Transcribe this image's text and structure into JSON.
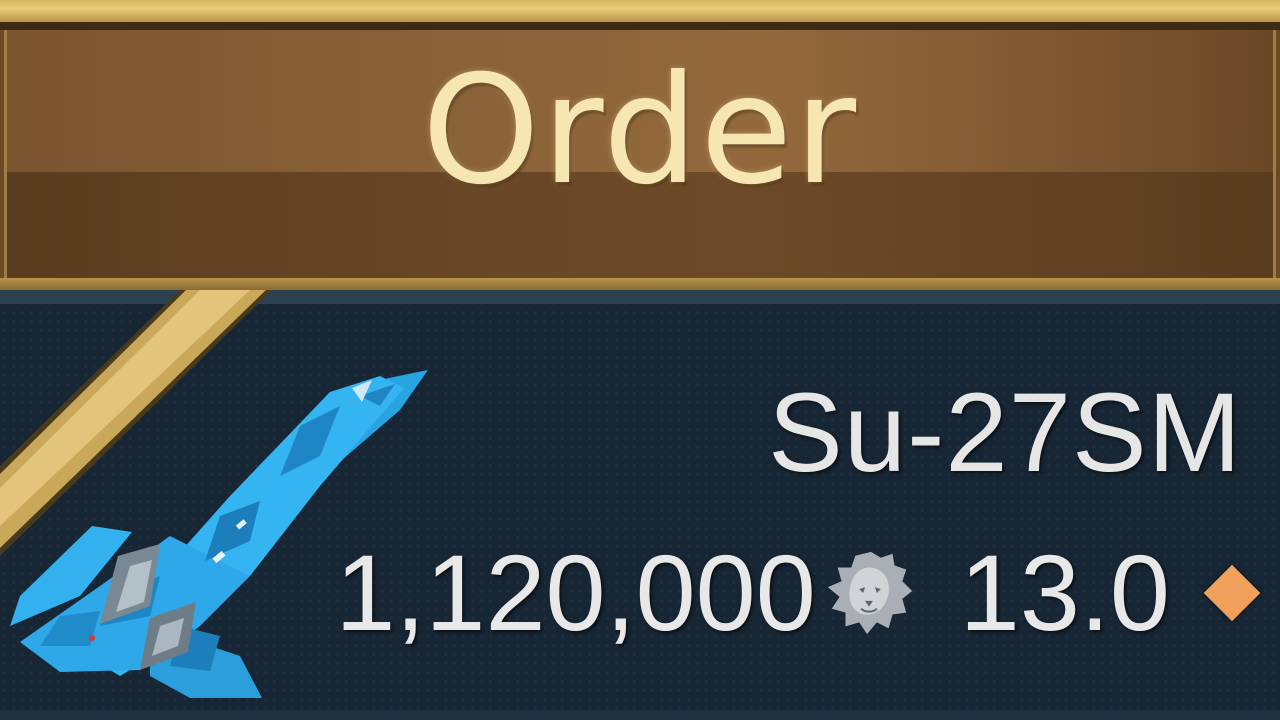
{
  "order_header": {
    "title": "Order"
  },
  "vehicle": {
    "name": "Su-27SM",
    "price": "1,120,000",
    "price_currency_icon": "lion-icon",
    "battle_rating": "13.0",
    "rank_marker_icon": "orange-diamond-icon",
    "vehicle_icon": "fighter-jet-icon"
  },
  "colors": {
    "header_gold": "#e8cc76",
    "header_bronze": "#8a6238",
    "title_text": "#f6e6b2",
    "card_background": "#172634",
    "jet_camo_blue": "#2ea8e8",
    "diamond_orange": "#f0a05a",
    "stripe_gold": "#d4b464"
  }
}
